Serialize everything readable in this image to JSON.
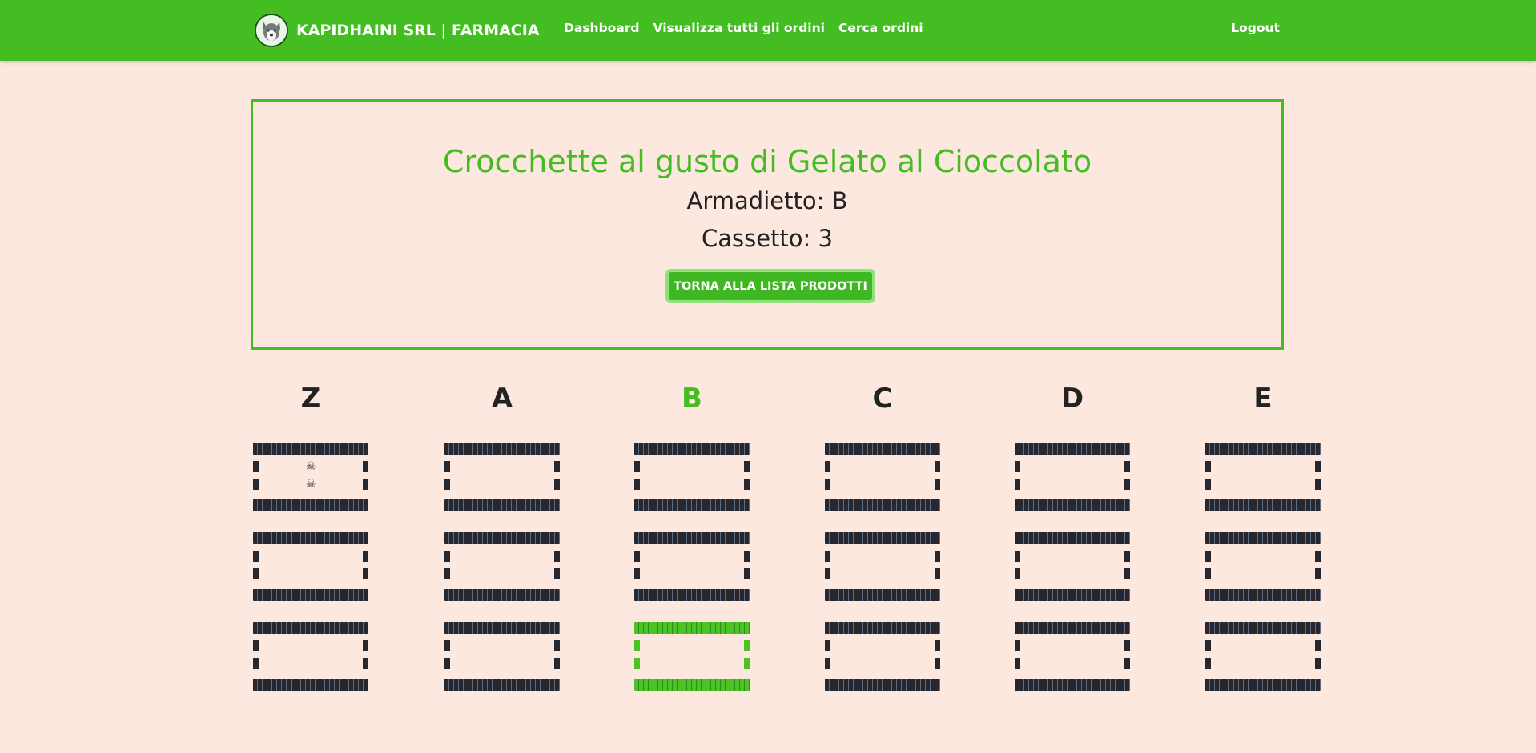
{
  "header": {
    "brand": "KAPIDHAINI SRL | FARMACIA",
    "nav": [
      "Dashboard",
      "Visualizza tutti gli ordini",
      "Cerca ordini"
    ],
    "logout": "Logout",
    "logo_icon": "husky-dog-logo",
    "accent_color": "#44bd22"
  },
  "product": {
    "name": "Crocchette al gusto di Gelato al Cioccolato",
    "cabinet_line": "Armadietto: B",
    "drawer_line": "Cassetto: 3",
    "back_button": "TORNA ALLA LISTA PRODOTTI"
  },
  "cabinets": [
    {
      "label": "Z",
      "active": false,
      "drawers": [
        {
          "active": false,
          "icons": [
            "skull-icon",
            "skull-icon"
          ]
        },
        {
          "active": false,
          "icons": []
        },
        {
          "active": false,
          "icons": []
        }
      ]
    },
    {
      "label": "A",
      "active": false,
      "drawers": [
        {
          "active": false,
          "icons": []
        },
        {
          "active": false,
          "icons": []
        },
        {
          "active": false,
          "icons": []
        }
      ]
    },
    {
      "label": "B",
      "active": true,
      "drawers": [
        {
          "active": false,
          "icons": []
        },
        {
          "active": false,
          "icons": []
        },
        {
          "active": true,
          "icons": []
        }
      ]
    },
    {
      "label": "C",
      "active": false,
      "drawers": [
        {
          "active": false,
          "icons": []
        },
        {
          "active": false,
          "icons": []
        },
        {
          "active": false,
          "icons": []
        }
      ]
    },
    {
      "label": "D",
      "active": false,
      "drawers": [
        {
          "active": false,
          "icons": []
        },
        {
          "active": false,
          "icons": []
        },
        {
          "active": false,
          "icons": []
        }
      ]
    },
    {
      "label": "E",
      "active": false,
      "drawers": [
        {
          "active": false,
          "icons": []
        },
        {
          "active": false,
          "icons": []
        },
        {
          "active": false,
          "icons": []
        }
      ]
    }
  ]
}
